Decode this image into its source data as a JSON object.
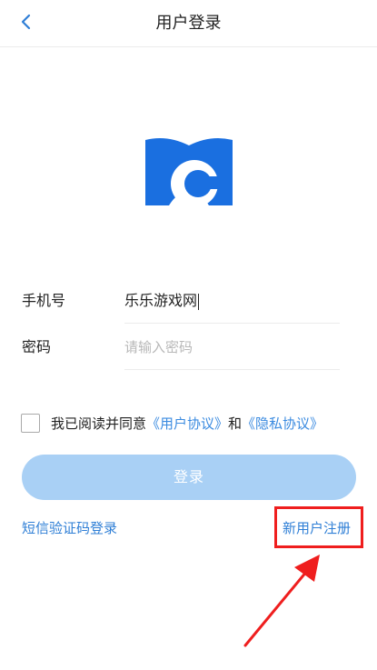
{
  "header": {
    "title": "用户登录",
    "back_icon": "chevron-left-icon"
  },
  "logo": {
    "icon": "open-book-c-logo",
    "color": "#1a6fe0"
  },
  "form": {
    "phone": {
      "label": "手机号",
      "value": "乐乐游戏网"
    },
    "password": {
      "label": "密码",
      "placeholder": "请输入密码"
    }
  },
  "agreement": {
    "prefix": "我已阅读并同意",
    "user_agreement": "《用户协议》",
    "connector": "和",
    "privacy_agreement": "《隐私协议》"
  },
  "actions": {
    "login_label": "登录",
    "sms_login_label": "短信验证码登录",
    "register_label": "新用户注册"
  },
  "annotation": {
    "highlight_color": "#ef1e1e",
    "target": "新用户注册"
  },
  "colors": {
    "accent": "#2f7fd6",
    "button_disabled": "#a9d0f5"
  }
}
